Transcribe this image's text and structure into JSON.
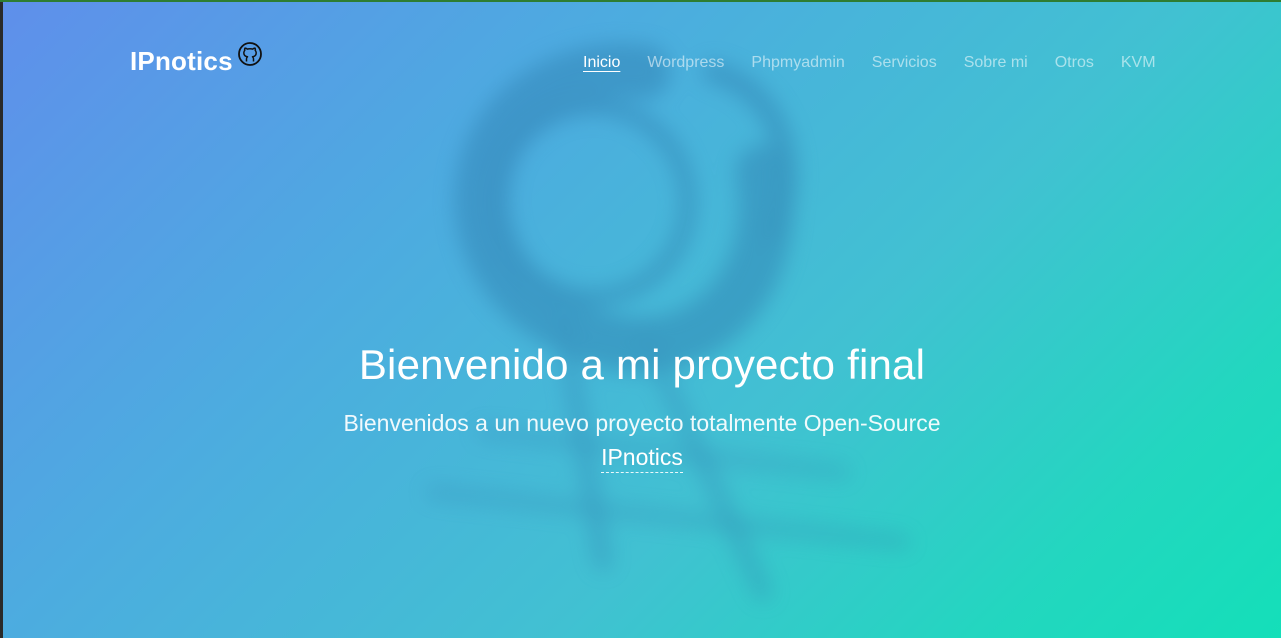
{
  "header": {
    "brand": "IPnotics",
    "github_icon": "github-icon",
    "nav": [
      {
        "label": "Inicio",
        "active": true
      },
      {
        "label": "Wordpress",
        "active": false
      },
      {
        "label": "Phpmyadmin",
        "active": false
      },
      {
        "label": "Servicios",
        "active": false
      },
      {
        "label": "Sobre mi",
        "active": false
      },
      {
        "label": "Otros",
        "active": false
      },
      {
        "label": "KVM",
        "active": false
      }
    ]
  },
  "hero": {
    "title": "Bienvenido a mi proyecto final",
    "subtitle": "Bienvenidos a un nuevo proyecto totalmente Open-Source",
    "link": "IPnotics"
  },
  "colors": {
    "gradient_start": "#5f8feb",
    "gradient_end": "#14dfb9",
    "text": "#ffffff"
  }
}
